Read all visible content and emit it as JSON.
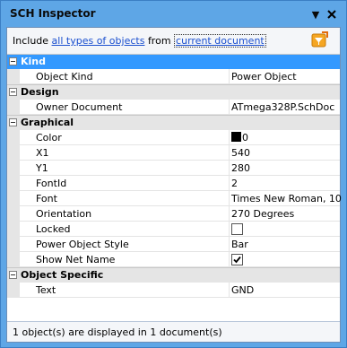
{
  "window": {
    "title": "SCH Inspector"
  },
  "filter": {
    "prefix": "Include",
    "object_types_link": "all types of objects",
    "middle": "from",
    "scope_link": "current document"
  },
  "categories": [
    {
      "label": "Kind",
      "selected": true,
      "props": [
        {
          "name": "Object Kind",
          "value": "Power Object"
        }
      ]
    },
    {
      "label": "Design",
      "selected": false,
      "props": [
        {
          "name": "Owner Document",
          "value": "ATmega328P.SchDoc"
        }
      ]
    },
    {
      "label": "Graphical",
      "selected": false,
      "props": [
        {
          "name": "Color",
          "value": "0",
          "color": "#000000"
        },
        {
          "name": "X1",
          "value": "540"
        },
        {
          "name": "Y1",
          "value": "280"
        },
        {
          "name": "FontId",
          "value": "2"
        },
        {
          "name": "Font",
          "value": "Times New Roman, 10"
        },
        {
          "name": "Orientation",
          "value": "270 Degrees"
        },
        {
          "name": "Locked",
          "checked": false
        },
        {
          "name": "Power Object Style",
          "value": "Bar"
        },
        {
          "name": "Show Net Name",
          "checked": true
        }
      ]
    },
    {
      "label": "Object Specific",
      "selected": false,
      "props": [
        {
          "name": "Text",
          "value": "GND"
        }
      ]
    }
  ],
  "status": {
    "text": "1 object(s) are displayed in 1 document(s)"
  },
  "icons": {
    "pin": "pin-icon",
    "close": "close-icon",
    "filter": "filter-icon"
  }
}
